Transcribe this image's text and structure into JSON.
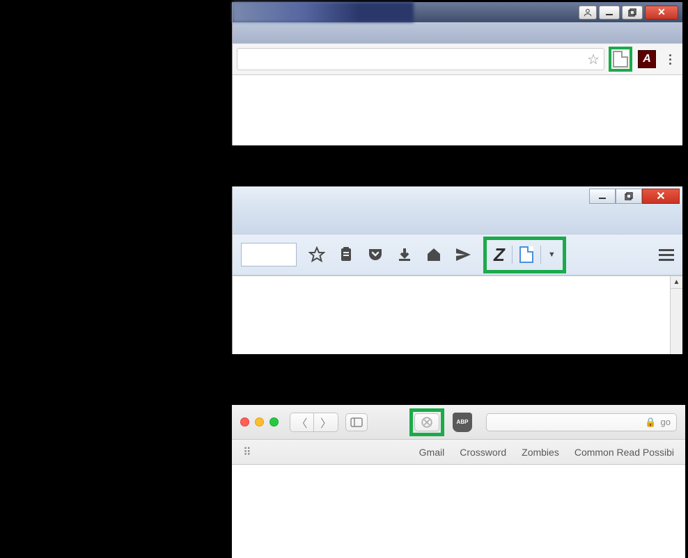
{
  "chrome": {
    "star_tooltip": "Bookmark",
    "adobe_label": "A",
    "menu_tooltip": "Menu"
  },
  "firefox": {
    "zotero_label": "Z",
    "scroll_up": "▲"
  },
  "safari": {
    "abp_label": "ABP",
    "lock": "🔒",
    "url_text": "go",
    "bookmarks": [
      "Gmail",
      "Crossword",
      "Zombies",
      "Common Read Possibi"
    ],
    "show_all": "⠿"
  }
}
